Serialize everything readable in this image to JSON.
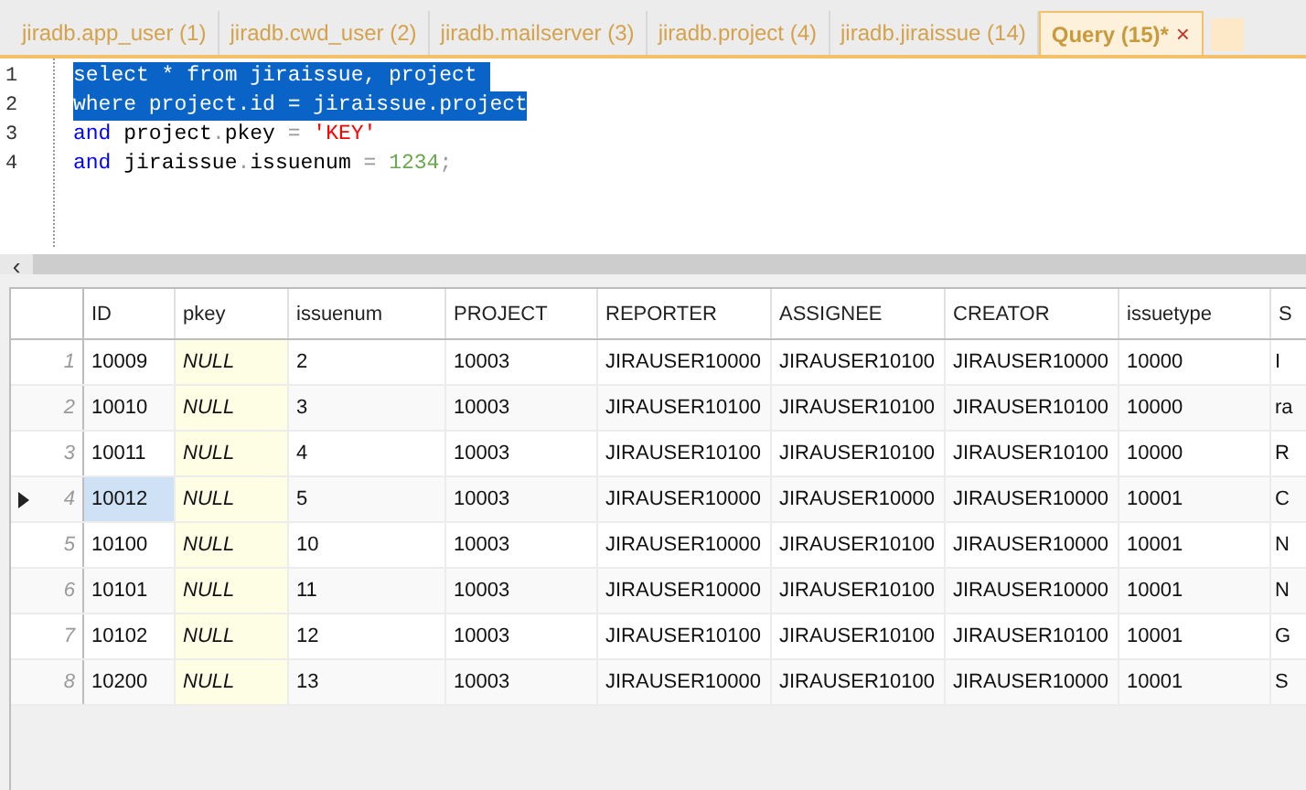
{
  "tabs": [
    {
      "label": "jiradb.app_user (1)",
      "selected": false
    },
    {
      "label": "jiradb.cwd_user (2)",
      "selected": false
    },
    {
      "label": "jiradb.mailserver (3)",
      "selected": false
    },
    {
      "label": "jiradb.project (4)",
      "selected": false
    },
    {
      "label": "jiradb.jiraissue (14)",
      "selected": false
    },
    {
      "label": "Query (15)*",
      "selected": true,
      "close": "×"
    }
  ],
  "editor": {
    "lines": [
      {
        "number": "1",
        "selected": true,
        "text": "select * from jiraissue, project "
      },
      {
        "number": "2",
        "selected": true,
        "text": "where project.id = jiraissue.project"
      },
      {
        "number": "3",
        "selected": false,
        "tokens": [
          {
            "kind": "keyword",
            "text": "and"
          },
          {
            "kind": "plain",
            "text": " project"
          },
          {
            "kind": "operator",
            "text": "."
          },
          {
            "kind": "plain",
            "text": "pkey "
          },
          {
            "kind": "operator",
            "text": "= "
          },
          {
            "kind": "string",
            "text": "'KEY'"
          }
        ]
      },
      {
        "number": "4",
        "selected": false,
        "tokens": [
          {
            "kind": "keyword",
            "text": "and"
          },
          {
            "kind": "plain",
            "text": " jiraissue"
          },
          {
            "kind": "operator",
            "text": "."
          },
          {
            "kind": "plain",
            "text": "issuenum "
          },
          {
            "kind": "operator",
            "text": "= "
          },
          {
            "kind": "number",
            "text": "1234"
          },
          {
            "kind": "operator",
            "text": ";"
          }
        ]
      }
    ]
  },
  "scrollbar": {
    "left_arrow": "‹"
  },
  "table": {
    "columns": [
      "ID",
      "pkey",
      "issuenum",
      "PROJECT",
      "REPORTER",
      "ASSIGNEE",
      "CREATOR",
      "issuetype",
      "S"
    ],
    "rows": [
      {
        "number": "1",
        "current": false,
        "cells": [
          "10009",
          "NULL",
          "2",
          "10003",
          "JIRAUSER10000",
          "JIRAUSER10100",
          "JIRAUSER10000",
          "10000",
          "I"
        ]
      },
      {
        "number": "2",
        "current": false,
        "cells": [
          "10010",
          "NULL",
          "3",
          "10003",
          "JIRAUSER10100",
          "JIRAUSER10100",
          "JIRAUSER10100",
          "10000",
          "ra"
        ]
      },
      {
        "number": "3",
        "current": false,
        "cells": [
          "10011",
          "NULL",
          "4",
          "10003",
          "JIRAUSER10100",
          "JIRAUSER10100",
          "JIRAUSER10100",
          "10000",
          "R"
        ]
      },
      {
        "number": "4",
        "current": true,
        "cells": [
          "10012",
          "NULL",
          "5",
          "10003",
          "JIRAUSER10000",
          "JIRAUSER10000",
          "JIRAUSER10000",
          "10001",
          "C"
        ]
      },
      {
        "number": "5",
        "current": false,
        "cells": [
          "10100",
          "NULL",
          "10",
          "10003",
          "JIRAUSER10000",
          "JIRAUSER10100",
          "JIRAUSER10000",
          "10001",
          "N"
        ]
      },
      {
        "number": "6",
        "current": false,
        "cells": [
          "10101",
          "NULL",
          "11",
          "10003",
          "JIRAUSER10000",
          "JIRAUSER10100",
          "JIRAUSER10000",
          "10001",
          "N"
        ]
      },
      {
        "number": "7",
        "current": false,
        "cells": [
          "10102",
          "NULL",
          "12",
          "10003",
          "JIRAUSER10100",
          "JIRAUSER10100",
          "JIRAUSER10100",
          "10001",
          "G"
        ]
      },
      {
        "number": "8",
        "current": false,
        "cells": [
          "10200",
          "NULL",
          "13",
          "10003",
          "JIRAUSER10000",
          "JIRAUSER10100",
          "JIRAUSER10000",
          "10001",
          "S"
        ]
      }
    ]
  }
}
